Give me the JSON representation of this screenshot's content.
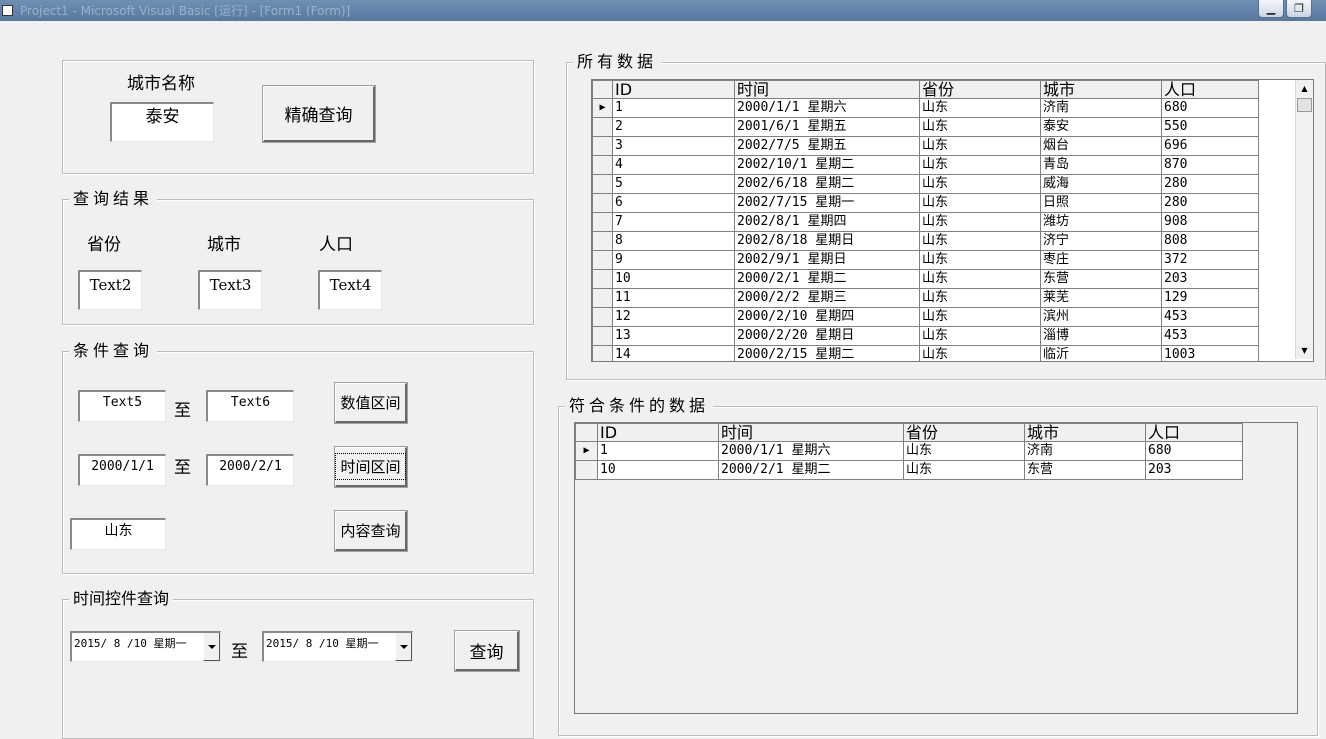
{
  "window": {
    "title": "Project1 - Microsoft Visual Basic [运行] - [Form1 (Form)]",
    "min_glyph": "▁",
    "max_glyph": "❐"
  },
  "exact_query": {
    "city_label": "城市名称",
    "city_value": "泰安",
    "button": "精确查询"
  },
  "result": {
    "legend": "查询结果",
    "province_label": "省份",
    "city_label": "城市",
    "population_label": "人口",
    "province_value": "Text2",
    "city_value": "Text3",
    "population_value": "Text4"
  },
  "conditions": {
    "legend": "条件查询",
    "num_from": "Text5",
    "num_to": "Text6",
    "to_label_1": "至",
    "num_button": "数值区间",
    "date_from": "2000/1/1",
    "date_to": "2000/2/1",
    "to_label_2": "至",
    "date_button": "时间区间",
    "content_value": "山东",
    "content_button": "内容查询"
  },
  "date_control": {
    "legend": "时间控件查询",
    "from": "2015/ 8 /10  星期一",
    "to": "2015/ 8 /10  星期一",
    "to_label": "至",
    "button": "查询"
  },
  "all_data": {
    "legend": "所有数据",
    "columns": [
      "ID",
      "时间",
      "省份",
      "城市",
      "人口"
    ],
    "rows": [
      [
        "1",
        "2000/1/1 星期六",
        "山东",
        "济南",
        "680"
      ],
      [
        "2",
        "2001/6/1 星期五",
        "山东",
        "泰安",
        "550"
      ],
      [
        "3",
        "2002/7/5 星期五",
        "山东",
        "烟台",
        "696"
      ],
      [
        "4",
        "2002/10/1 星期二",
        "山东",
        "青岛",
        "870"
      ],
      [
        "5",
        "2002/6/18 星期二",
        "山东",
        "威海",
        "280"
      ],
      [
        "6",
        "2002/7/15 星期一",
        "山东",
        "日照",
        "280"
      ],
      [
        "7",
        "2002/8/1 星期四",
        "山东",
        "潍坊",
        "908"
      ],
      [
        "8",
        "2002/8/18 星期日",
        "山东",
        "济宁",
        "808"
      ],
      [
        "9",
        "2002/9/1 星期日",
        "山东",
        "枣庄",
        "372"
      ],
      [
        "10",
        "2000/2/1 星期二",
        "山东",
        "东营",
        "203"
      ],
      [
        "11",
        "2000/2/2 星期三",
        "山东",
        "莱芜",
        "129"
      ],
      [
        "12",
        "2000/2/10 星期四",
        "山东",
        "滨州",
        "453"
      ],
      [
        "13",
        "2000/2/20 星期日",
        "山东",
        "淄博",
        "453"
      ],
      [
        "14",
        "2000/2/15 星期二",
        "山东",
        "临沂",
        "1003"
      ]
    ]
  },
  "matched_data": {
    "legend": "符合条件的数据",
    "columns": [
      "ID",
      "时间",
      "省份",
      "城市",
      "人口"
    ],
    "rows": [
      [
        "1",
        "2000/1/1 星期六",
        "山东",
        "济南",
        "680"
      ],
      [
        "10",
        "2000/2/1 星期二",
        "山东",
        "东营",
        "203"
      ]
    ]
  }
}
